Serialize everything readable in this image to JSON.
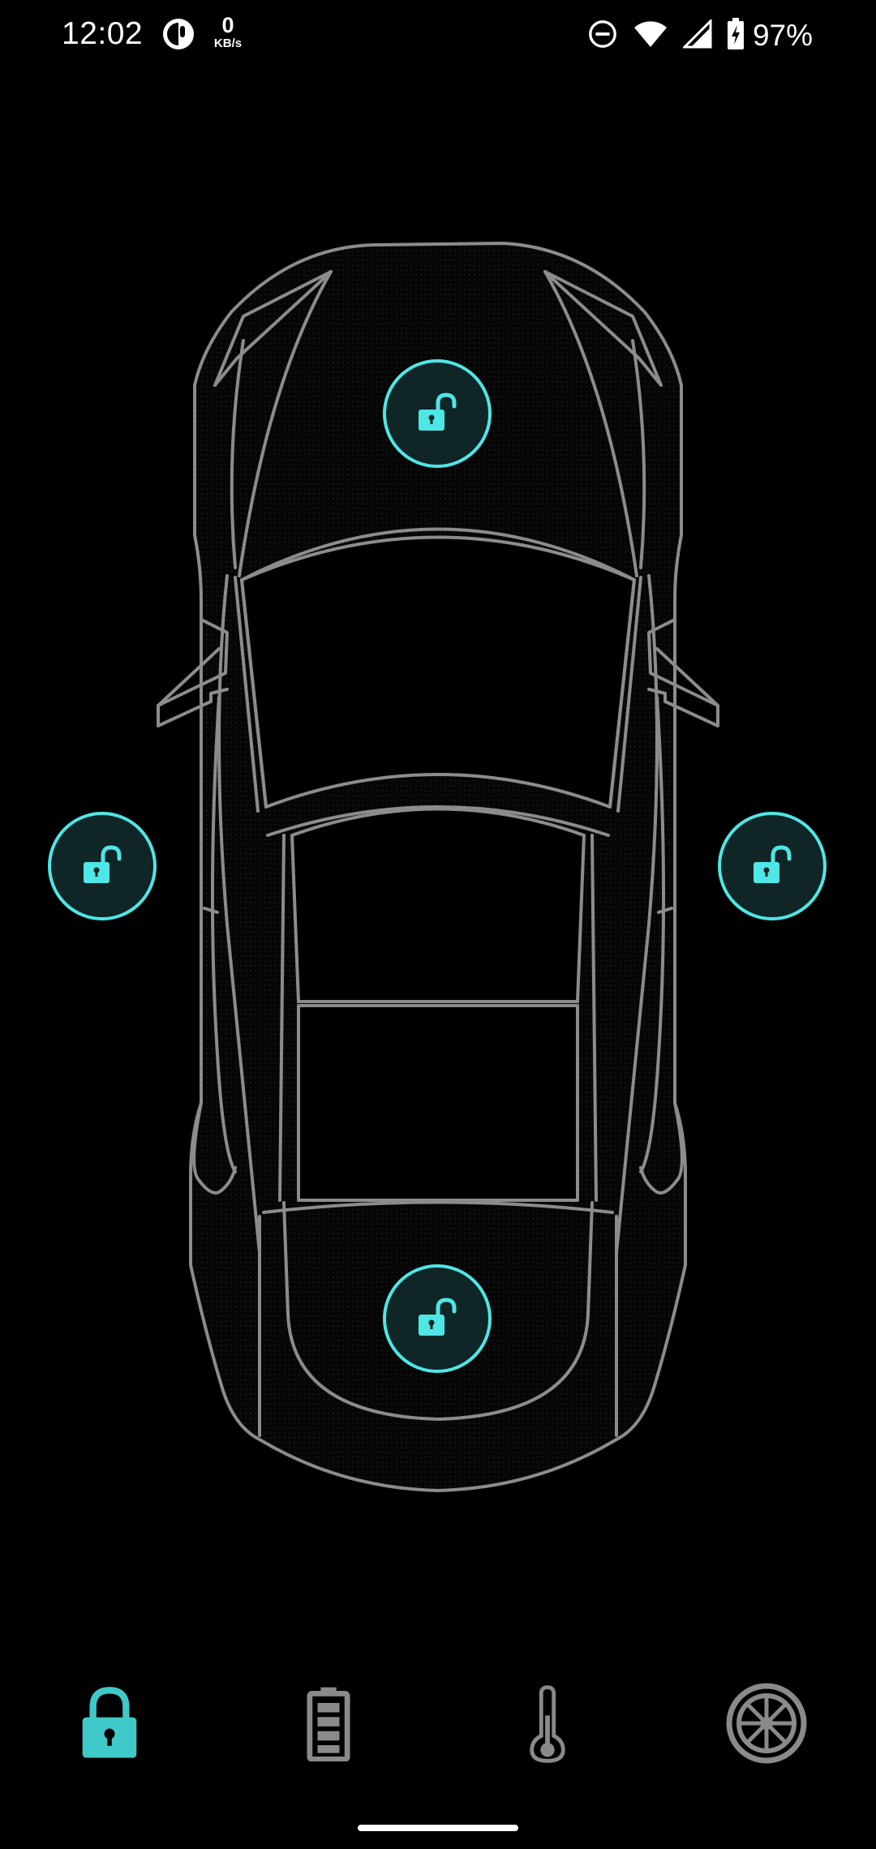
{
  "status_bar": {
    "time": "12:02",
    "net_speed_value": "0",
    "net_speed_unit": "KB/s",
    "battery_percent": "97%",
    "icons": [
      "app-notification-icon",
      "do-not-disturb-icon",
      "wifi-icon",
      "cellular-signal-icon",
      "battery-charging-icon"
    ]
  },
  "locks": {
    "front": {
      "icon": "unlocked-icon",
      "state": "unlocked"
    },
    "left": {
      "icon": "unlocked-icon",
      "state": "unlocked"
    },
    "right": {
      "icon": "unlocked-icon",
      "state": "unlocked"
    },
    "rear": {
      "icon": "unlocked-icon",
      "state": "unlocked"
    }
  },
  "bottom_nav": {
    "active": "lock",
    "items": [
      {
        "id": "lock",
        "icon": "lock-icon"
      },
      {
        "id": "battery",
        "icon": "battery-icon"
      },
      {
        "id": "temperature",
        "icon": "thermometer-icon"
      },
      {
        "id": "tyre",
        "icon": "tyre-icon"
      }
    ]
  },
  "colors": {
    "accent": "#4fe6e6",
    "nav_active": "#3fc9c9",
    "nav_inactive": "#8a8a8a",
    "car_outline": "#8c8c8c",
    "background": "#000000"
  }
}
